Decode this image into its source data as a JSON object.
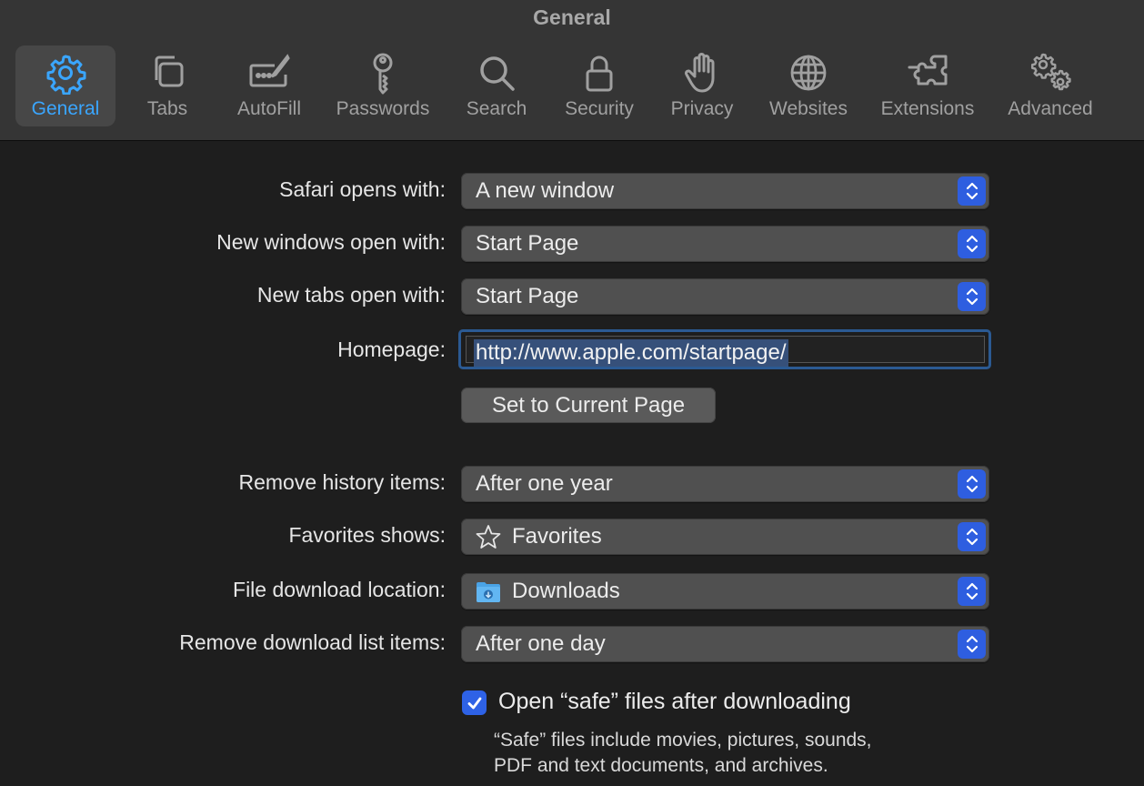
{
  "window": {
    "title": "General"
  },
  "toolbar": {
    "items": [
      {
        "label": "General",
        "icon": "gear-icon",
        "selected": true
      },
      {
        "label": "Tabs",
        "icon": "tabs-icon"
      },
      {
        "label": "AutoFill",
        "icon": "autofill-icon"
      },
      {
        "label": "Passwords",
        "icon": "key-icon"
      },
      {
        "label": "Search",
        "icon": "search-icon"
      },
      {
        "label": "Security",
        "icon": "lock-icon"
      },
      {
        "label": "Privacy",
        "icon": "hand-icon"
      },
      {
        "label": "Websites",
        "icon": "globe-icon"
      },
      {
        "label": "Extensions",
        "icon": "puzzle-icon"
      },
      {
        "label": "Advanced",
        "icon": "gears-icon"
      }
    ]
  },
  "settings": {
    "safari_opens": {
      "label": "Safari opens with:",
      "value": "A new window"
    },
    "new_windows": {
      "label": "New windows open with:",
      "value": "Start Page"
    },
    "new_tabs": {
      "label": "New tabs open with:",
      "value": "Start Page"
    },
    "homepage": {
      "label": "Homepage:",
      "value": "http://www.apple.com/startpage/"
    },
    "set_current_button": "Set to Current Page",
    "remove_history": {
      "label": "Remove history items:",
      "value": "After one year"
    },
    "favorites_shows": {
      "label": "Favorites shows:",
      "value": "Favorites",
      "icon": "star-icon"
    },
    "download_location": {
      "label": "File download location:",
      "value": "Downloads",
      "icon": "downloads-folder-icon"
    },
    "remove_download": {
      "label": "Remove download list items:",
      "value": "After one day"
    },
    "open_safe": {
      "label": "Open “safe” files after downloading",
      "checked": true,
      "help_line1": "“Safe” files include movies, pictures, sounds,",
      "help_line2": "PDF and text documents, and archives."
    }
  },
  "colors": {
    "accent": "#2e62e6",
    "selected_label": "#3aa6ff",
    "background": "#1e1e1e",
    "toolbar": "#353535"
  }
}
